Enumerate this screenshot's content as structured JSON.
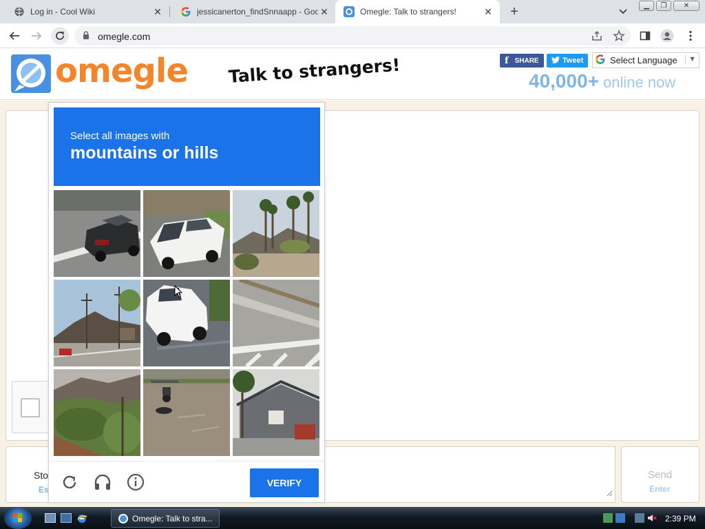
{
  "browser": {
    "tabs": [
      {
        "title": "Log in - Cool Wiki",
        "favicon": "globe-icon",
        "active": false
      },
      {
        "title": "jessicanerton_findSnnaapp - Goo",
        "favicon": "google-icon",
        "active": false
      },
      {
        "title": "Omegle: Talk to strangers!",
        "favicon": "omegle-icon",
        "active": true
      }
    ],
    "url": "omegle.com"
  },
  "site": {
    "logo_text": "omegle",
    "tagline": "Talk to strangers!",
    "share_label": "SHARE",
    "tweet_label": "Tweet",
    "language_select": "Select Language",
    "online_count": "40,000+",
    "online_text": "online now",
    "colors": {
      "brand_orange": "#f4852a",
      "online_blue": "#7fb6e6"
    }
  },
  "chat": {
    "stop_label": "Sto",
    "stop_key": "Esc",
    "send_label": "Send",
    "send_key": "Enter"
  },
  "captcha": {
    "instruction": "Select all images with",
    "target": "mountains or hills",
    "tiles": [
      {
        "subject": "car on road"
      },
      {
        "subject": "white van"
      },
      {
        "subject": "palm trees and mountain"
      },
      {
        "subject": "mountain and street"
      },
      {
        "subject": "white car"
      },
      {
        "subject": "road crosswalk"
      },
      {
        "subject": "hill with palms"
      },
      {
        "subject": "motorcycle on road"
      },
      {
        "subject": "house with palm"
      }
    ],
    "verify_label": "VERIFY",
    "colors": {
      "header": "#1a73e8"
    }
  },
  "taskbar": {
    "window_label": "Omegle: Talk to stra...",
    "clock": "2:39 PM"
  }
}
